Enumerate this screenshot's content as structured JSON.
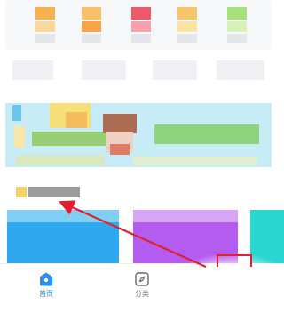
{
  "tabbar": {
    "tabs": [
      {
        "label": "首页",
        "icon": "home-icon",
        "active": true
      },
      {
        "label": "分类",
        "icon": "category-icon",
        "active": false
      }
    ]
  },
  "colors": {
    "accent": "#2d8cf0",
    "annotation": "#e0202a",
    "banner_bg": "#c7ecf5",
    "tile_blue": "#2fa8ef",
    "tile_purple": "#b45cf0",
    "tile_teal": "#2ad7d0"
  }
}
